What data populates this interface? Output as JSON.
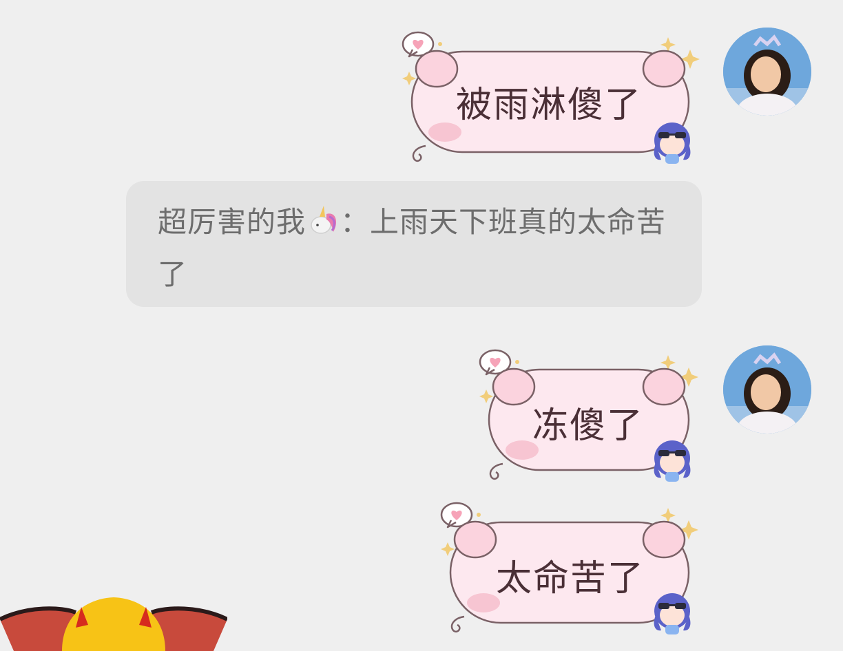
{
  "messages": [
    {
      "id": 1,
      "side": "right",
      "text": "被雨淋傻了",
      "has_avatar": true
    },
    {
      "id": 2,
      "type": "recall_notice",
      "sender": "超厉害的我",
      "sender_emoji": "unicorn-icon",
      "separator": "：",
      "text": "上雨天下班真的太命苦了"
    },
    {
      "id": 3,
      "side": "right",
      "text": "冻傻了",
      "has_avatar": true
    },
    {
      "id": 4,
      "side": "right",
      "text": "太命苦了",
      "has_avatar": false
    }
  ],
  "bubble_style": {
    "fill": "#fde8ef",
    "stroke": "#7a6166",
    "ear_fill": "#fbd3de",
    "blush": "#f7c5d2",
    "text_color": "#4a2f36"
  },
  "colors": {
    "background": "#efefef",
    "recall_bg": "#e3e3e3",
    "recall_text": "#6d6d6d"
  }
}
